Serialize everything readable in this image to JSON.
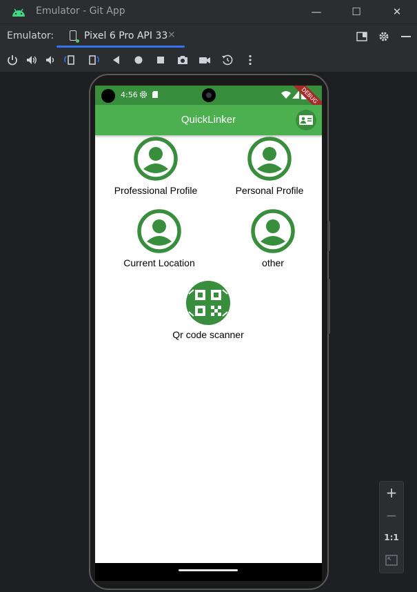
{
  "window": {
    "title": "Emulator - Git App",
    "minimize_glyph": "—",
    "maximize_glyph": "☐",
    "close_glyph": "✕"
  },
  "tabs": {
    "prefix": "Emulator:",
    "active": {
      "label": "Pixel 6 Pro API 33",
      "close_glyph": "✕",
      "icon": "phone-device-icon"
    }
  },
  "toolbar": {
    "icons": [
      "power-icon",
      "volume-up-icon",
      "volume-down-icon",
      "rotate-left-icon",
      "rotate-right-icon",
      "back-icon",
      "home-icon",
      "overview-icon",
      "screenshot-icon",
      "screen-record-icon",
      "snapshot-icon",
      "more-icon"
    ]
  },
  "device": {
    "status": {
      "time": "4:56",
      "debug_label": "DEBUG"
    },
    "app": {
      "title": "QuickLinker",
      "items": [
        {
          "label": "Professional Profile",
          "icon": "account-circle-icon"
        },
        {
          "label": "Personal Profile",
          "icon": "account-circle-icon"
        },
        {
          "label": "Current Location",
          "icon": "account-circle-icon"
        },
        {
          "label": "other",
          "icon": "account-circle-icon"
        },
        {
          "label": "Qr code scanner",
          "icon": "qr-code-icon"
        }
      ]
    }
  },
  "zoom": {
    "zoom_in": "+",
    "zoom_out": "−",
    "actual_size": "1:1"
  },
  "colors": {
    "appbar": "#4caf50",
    "statusbar": "#388e3c",
    "icon_green": "#388e3c",
    "accent_blue": "#3574f0"
  }
}
